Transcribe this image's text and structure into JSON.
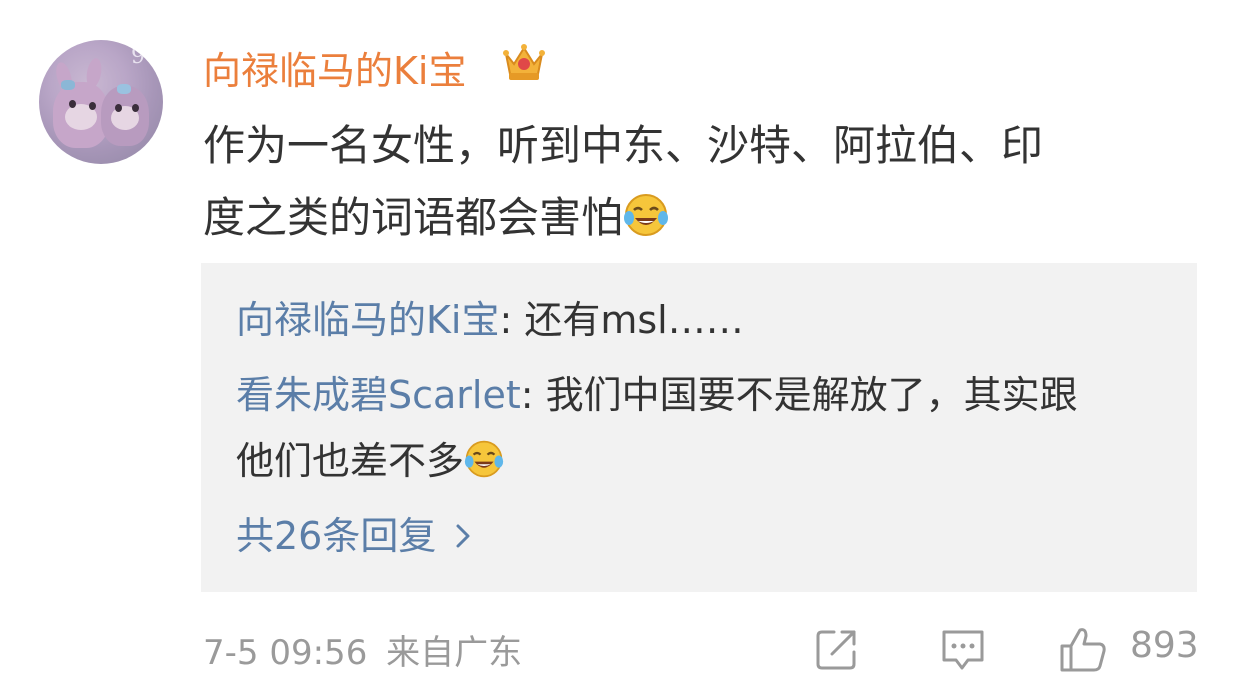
{
  "post": {
    "username": "向禄临马的Ki宝",
    "content_line1": "作为一名女性，听到中东、沙特、阿拉伯、印",
    "content_line2": "度之类的词语都会害怕",
    "time": "7-5 09:56",
    "source": "来自广东",
    "likes": "893"
  },
  "replies": [
    {
      "name": "向禄临马的Ki宝",
      "text": ": 还有msl……"
    },
    {
      "name": "看朱成碧Scarlet",
      "text": ": 我们中国要不是解放了，其实跟",
      "text2": "他们也差不多"
    }
  ],
  "more_replies": "共26条回复",
  "icons": {
    "crown": "crown-icon",
    "laugh": "laugh-cry-emoji",
    "share": "share-icon",
    "comment": "comment-icon",
    "like": "thumbs-up-icon",
    "chevron": "chevron-right-icon"
  },
  "colors": {
    "username": "#eb7f3c",
    "reply_name": "#5b7ea8",
    "meta": "#9a9a9a",
    "reply_bg": "#f2f2f2"
  }
}
